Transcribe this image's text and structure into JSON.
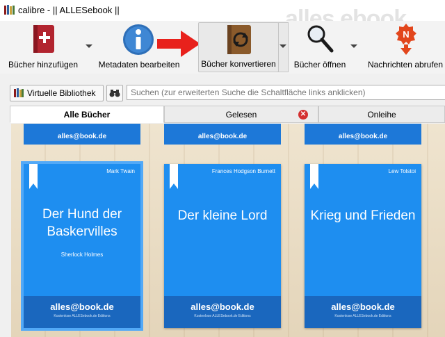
{
  "window": {
    "title": "calibre - || ALLESebook ||",
    "watermark": "alles ebook"
  },
  "toolbar": {
    "add_books": "Bücher hinzufügen",
    "edit_metadata": "Metadaten bearbeiten",
    "convert_books": "Bücher konvertieren",
    "open_books": "Bücher öffnen",
    "fetch_news": "Nachrichten abrufen"
  },
  "search": {
    "virtual_library": "Virtuelle Bibliothek",
    "placeholder": "Suchen (zur erweiterten Suche die Schaltfläche links anklicken)"
  },
  "tabs": [
    "Alle Bücher",
    "Gelesen",
    "Onleihe"
  ],
  "books": [
    {
      "author": "Mark Twain",
      "title": "Der Hund der Baskervilles",
      "series": "Sherlock Holmes"
    },
    {
      "author": "Frances Hodgson Burnett",
      "title": "Der kleine Lord",
      "series": ""
    },
    {
      "author": "Lew Tolstoi",
      "title": "Krieg und Frieden",
      "series": ""
    }
  ],
  "cover": {
    "logo": "alles@book.de",
    "tagline": "Kostenlose ALLESebook.de Editions"
  },
  "colors": {
    "cover_blue": "#1e8ef0",
    "cover_footer": "#1a67be",
    "selection": "#52a9f7",
    "arrow": "#e8211c"
  }
}
